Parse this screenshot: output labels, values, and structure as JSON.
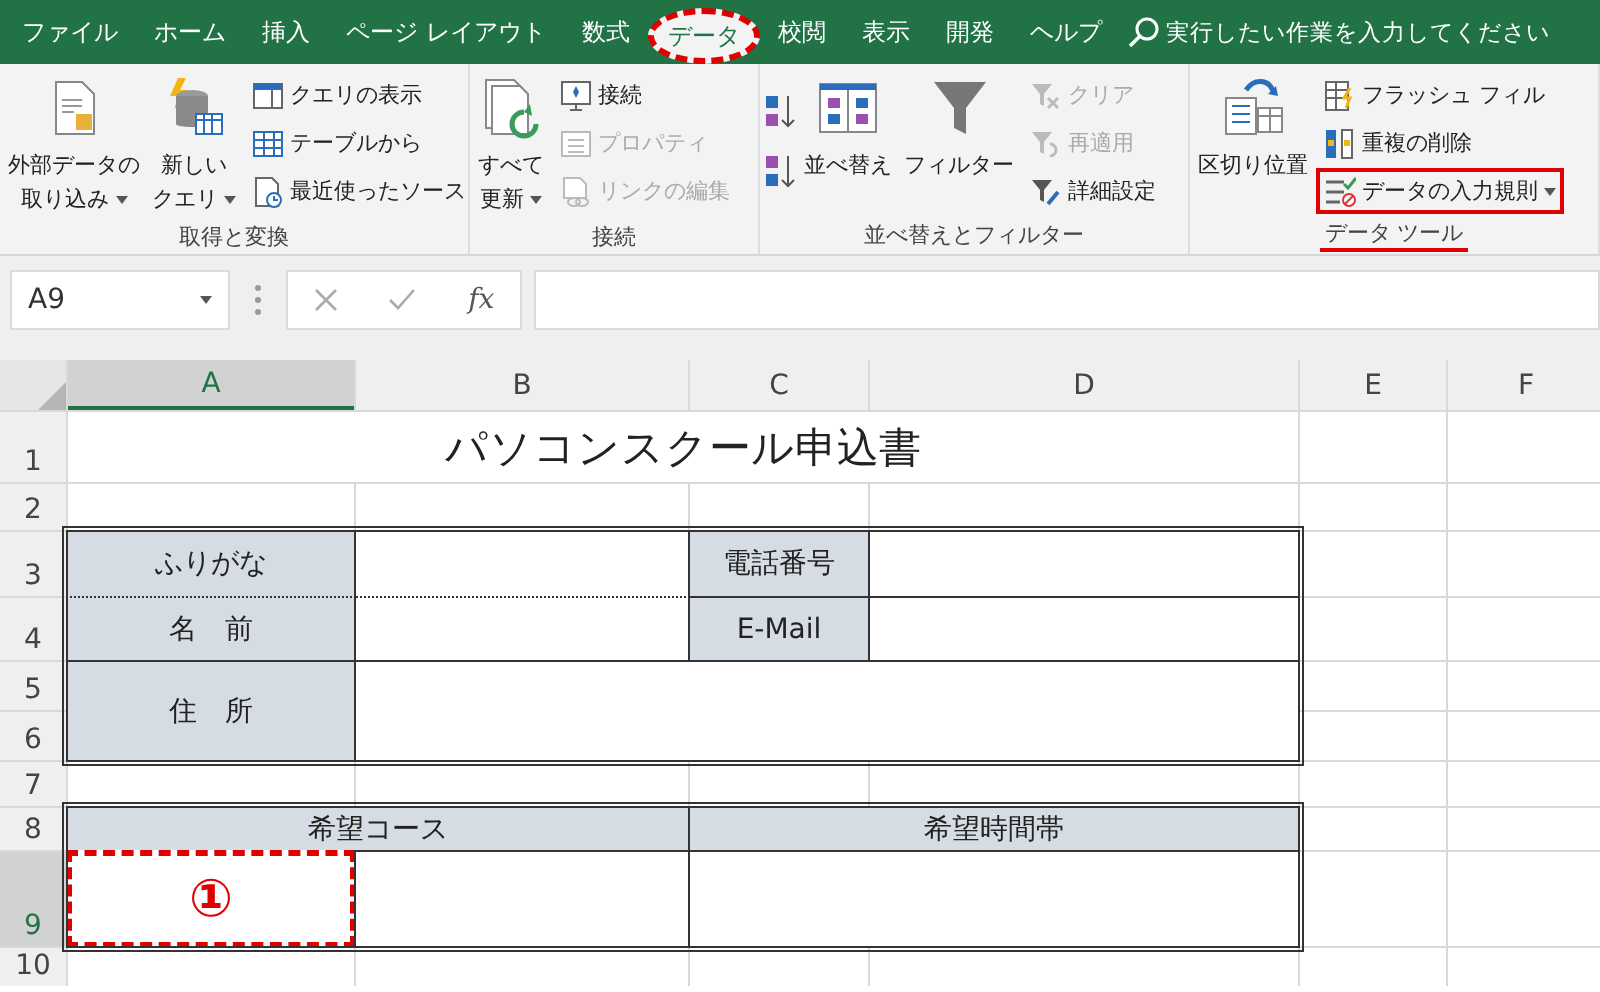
{
  "menu_tabs": [
    {
      "label": "ファイル",
      "selected": false,
      "highlighted": false
    },
    {
      "label": "ホーム",
      "selected": false,
      "highlighted": false
    },
    {
      "label": "挿入",
      "selected": false,
      "highlighted": false
    },
    {
      "label": "ページ レイアウト",
      "selected": false,
      "highlighted": false
    },
    {
      "label": "数式",
      "selected": false,
      "highlighted": false
    },
    {
      "label": "データ",
      "selected": true,
      "highlighted": true
    },
    {
      "label": "校閲",
      "selected": false,
      "highlighted": false
    },
    {
      "label": "表示",
      "selected": false,
      "highlighted": false
    },
    {
      "label": "開発",
      "selected": false,
      "highlighted": false
    },
    {
      "label": "ヘルプ",
      "selected": false,
      "highlighted": false
    }
  ],
  "search": {
    "placeholder": "実行したい作業を入力してください"
  },
  "ribbon": [
    {
      "label": "取得と変換",
      "highlighted": false,
      "items": [
        {
          "kind": "large",
          "lines": [
            "外部データの",
            "取り込み"
          ],
          "dropdown": true
        },
        {
          "kind": "large",
          "lines": [
            "新しい",
            "クエリ"
          ],
          "dropdown": true
        },
        {
          "kind": "stack",
          "items": [
            {
              "label": "クエリの表示",
              "disabled": false,
              "dropdown": false,
              "highlighted": false
            },
            {
              "label": "テーブルから",
              "disabled": false,
              "dropdown": false,
              "highlighted": false
            },
            {
              "label": "最近使ったソース",
              "disabled": false,
              "dropdown": false,
              "highlighted": false
            }
          ]
        }
      ]
    },
    {
      "label": "接続",
      "highlighted": false,
      "items": [
        {
          "kind": "large",
          "lines": [
            "すべて",
            "更新"
          ],
          "dropdown": true
        },
        {
          "kind": "stack",
          "items": [
            {
              "label": "接続",
              "disabled": false,
              "dropdown": false,
              "highlighted": false
            },
            {
              "label": "プロパティ",
              "disabled": true,
              "dropdown": false,
              "highlighted": false
            },
            {
              "label": "リンクの編集",
              "disabled": true,
              "dropdown": false,
              "highlighted": false
            }
          ]
        }
      ]
    },
    {
      "label": "並べ替えとフィルター",
      "highlighted": false,
      "items": [
        {
          "kind": "sortpair"
        },
        {
          "kind": "large",
          "lines": [
            "並べ替え"
          ],
          "dropdown": false
        },
        {
          "kind": "large",
          "lines": [
            "フィルター"
          ],
          "dropdown": false
        },
        {
          "kind": "stack",
          "items": [
            {
              "label": "クリア",
              "disabled": true,
              "dropdown": false,
              "highlighted": false
            },
            {
              "label": "再適用",
              "disabled": true,
              "dropdown": false,
              "highlighted": false
            },
            {
              "label": "詳細設定",
              "disabled": false,
              "dropdown": false,
              "highlighted": false
            }
          ]
        }
      ]
    },
    {
      "label": "データ ツール",
      "highlighted": true,
      "items": [
        {
          "kind": "large",
          "lines": [
            "区切り位置"
          ],
          "dropdown": false
        },
        {
          "kind": "stack",
          "items": [
            {
              "label": "フラッシュ フィル",
              "disabled": false,
              "dropdown": false,
              "highlighted": false
            },
            {
              "label": "重複の削除",
              "disabled": false,
              "dropdown": false,
              "highlighted": false
            },
            {
              "label": "データの入力規則",
              "disabled": false,
              "dropdown": true,
              "highlighted": true
            }
          ]
        }
      ]
    }
  ],
  "formula_bar": {
    "name_box": "A9",
    "fx": "fx"
  },
  "columns": [
    {
      "label": "A",
      "selected": true
    },
    {
      "label": "B",
      "selected": false
    },
    {
      "label": "C",
      "selected": false
    },
    {
      "label": "D",
      "selected": false
    },
    {
      "label": "E",
      "selected": false
    },
    {
      "label": "F",
      "selected": false
    }
  ],
  "rows": [
    {
      "header": "1",
      "selected": false,
      "cells": [
        {
          "kind": "title",
          "text": "パソコンスクール申込書",
          "selected": false
        }
      ]
    },
    {
      "header": "2",
      "selected": false,
      "cells": []
    },
    {
      "header": "3",
      "selected": false,
      "cells": [
        {
          "kind": "label",
          "text": "ふりがな",
          "selected": false
        },
        {
          "kind": "input",
          "selected": false
        },
        {
          "kind": "label",
          "text": "電話番号",
          "selected": false
        },
        {
          "kind": "input",
          "selected": false
        }
      ]
    },
    {
      "header": "4",
      "selected": false,
      "cells": [
        {
          "kind": "label",
          "text": "名　前",
          "selected": false
        },
        {
          "kind": "input",
          "selected": false
        },
        {
          "kind": "label",
          "text": "E-Mail",
          "selected": false
        },
        {
          "kind": "input",
          "selected": false
        }
      ]
    },
    {
      "header": "5",
      "selected": false,
      "cells": [
        {
          "kind": "label",
          "text": "住　所",
          "selected": false
        },
        {
          "kind": "input",
          "selected": false
        }
      ]
    },
    {
      "header": "6",
      "selected": false,
      "cells": []
    },
    {
      "header": "7",
      "selected": false,
      "cells": []
    },
    {
      "header": "8",
      "selected": false,
      "cells": [
        {
          "kind": "label",
          "text": "希望コース",
          "selected": false
        },
        {
          "kind": "label",
          "text": "希望時間帯",
          "selected": false
        }
      ]
    },
    {
      "header": "9",
      "selected": true,
      "cells": [
        {
          "kind": "input",
          "text": "①",
          "selected": true
        },
        {
          "kind": "input",
          "selected": false
        },
        {
          "kind": "input",
          "selected": false
        }
      ]
    },
    {
      "header": "10",
      "selected": false,
      "cells": []
    }
  ]
}
